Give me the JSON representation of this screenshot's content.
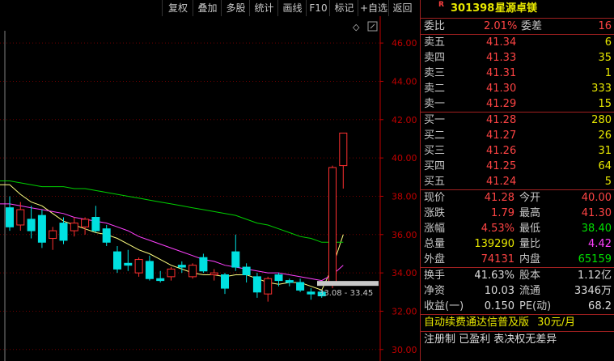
{
  "toolbar": {
    "items": [
      "复权",
      "叠加",
      "多股",
      "统计",
      "画线",
      "F10",
      "标记",
      "+自选",
      "返回"
    ]
  },
  "chart_area": {
    "diamond_icon": "◇",
    "y_axis_labels": [
      "46.00",
      "44.00",
      "42.00",
      "40.00",
      "38.00",
      "36.00",
      "34.00",
      "32.00",
      "30.00"
    ],
    "range_label": "33.08 - 33.45"
  },
  "chart_data": {
    "type": "candlestick",
    "ylim": [
      29.4,
      47.4
    ],
    "candles": [
      {
        "o": 37.4,
        "h": 38.0,
        "l": 36.2,
        "c": 36.4
      },
      {
        "o": 36.5,
        "h": 37.7,
        "l": 36.2,
        "c": 37.3
      },
      {
        "o": 36.8,
        "h": 37.5,
        "l": 35.8,
        "c": 36.2
      },
      {
        "o": 37.0,
        "h": 37.3,
        "l": 35.3,
        "c": 35.6
      },
      {
        "o": 35.8,
        "h": 36.4,
        "l": 35.2,
        "c": 36.2
      },
      {
        "o": 36.6,
        "h": 36.9,
        "l": 35.5,
        "c": 35.7
      },
      {
        "o": 36.2,
        "h": 36.9,
        "l": 35.9,
        "c": 36.6
      },
      {
        "o": 36.4,
        "h": 36.9,
        "l": 36.0,
        "c": 36.8
      },
      {
        "o": 36.9,
        "h": 37.5,
        "l": 36.1,
        "c": 36.2
      },
      {
        "o": 36.3,
        "h": 36.5,
        "l": 35.4,
        "c": 35.6
      },
      {
        "o": 35.1,
        "h": 35.4,
        "l": 34.0,
        "c": 34.2
      },
      {
        "o": 34.5,
        "h": 35.2,
        "l": 34.1,
        "c": 34.4
      },
      {
        "o": 34.0,
        "h": 34.8,
        "l": 33.8,
        "c": 34.7
      },
      {
        "o": 34.6,
        "h": 34.9,
        "l": 33.6,
        "c": 33.7
      },
      {
        "o": 33.7,
        "h": 34.1,
        "l": 33.5,
        "c": 33.6
      },
      {
        "o": 33.8,
        "h": 34.3,
        "l": 33.6,
        "c": 34.2
      },
      {
        "o": 34.4,
        "h": 34.6,
        "l": 34.0,
        "c": 34.3
      },
      {
        "o": 33.8,
        "h": 34.5,
        "l": 33.7,
        "c": 34.4
      },
      {
        "o": 34.8,
        "h": 35.0,
        "l": 34.0,
        "c": 34.1
      },
      {
        "o": 33.9,
        "h": 34.2,
        "l": 33.6,
        "c": 34.0
      },
      {
        "o": 33.9,
        "h": 34.0,
        "l": 32.9,
        "c": 33.2
      },
      {
        "o": 35.1,
        "h": 36.0,
        "l": 34.1,
        "c": 34.3
      },
      {
        "o": 34.3,
        "h": 34.5,
        "l": 33.5,
        "c": 33.9
      },
      {
        "o": 33.8,
        "h": 34.0,
        "l": 32.7,
        "c": 33.0
      },
      {
        "o": 32.9,
        "h": 33.8,
        "l": 32.5,
        "c": 33.7
      },
      {
        "o": 33.9,
        "h": 34.0,
        "l": 33.3,
        "c": 33.6
      },
      {
        "o": 33.6,
        "h": 33.7,
        "l": 33.3,
        "c": 33.5
      },
      {
        "o": 33.5,
        "h": 33.7,
        "l": 33.0,
        "c": 33.1
      },
      {
        "o": 33.0,
        "h": 33.2,
        "l": 32.6,
        "c": 32.9
      },
      {
        "o": 33.0,
        "h": 33.1,
        "l": 32.7,
        "c": 32.8
      },
      {
        "o": 33.5,
        "h": 39.6,
        "l": 33.2,
        "c": 39.5
      },
      {
        "o": 39.6,
        "h": 41.3,
        "l": 38.4,
        "c": 41.3
      }
    ],
    "ma_lines": [
      {
        "name": "ma5",
        "color": "#ffff80",
        "values": [
          38.6,
          38.1,
          37.7,
          37.5,
          37.1,
          36.7,
          36.5,
          36.3,
          36.1,
          36.0,
          35.8,
          35.5,
          35.2,
          35.0,
          34.7,
          34.4,
          34.2,
          34.0,
          33.9,
          33.9,
          33.8,
          33.9,
          33.9,
          33.7,
          33.5,
          33.4,
          33.5,
          33.5,
          33.3,
          33.1,
          34.3,
          36.0
        ]
      },
      {
        "name": "ma10",
        "color": "#ff40ff",
        "values": [
          37.6,
          37.5,
          37.4,
          37.3,
          37.2,
          37.1,
          36.9,
          36.8,
          36.7,
          36.6,
          36.4,
          36.2,
          35.9,
          35.7,
          35.5,
          35.3,
          35.1,
          34.9,
          34.7,
          34.6,
          34.4,
          34.3,
          34.2,
          34.1,
          34.0,
          34.0,
          33.9,
          33.8,
          33.7,
          33.6,
          33.9,
          34.4
        ]
      },
      {
        "name": "ma20",
        "color": "#00d000",
        "values": [
          38.8,
          38.7,
          38.6,
          38.5,
          38.5,
          38.5,
          38.4,
          38.4,
          38.3,
          38.2,
          38.1,
          38.0,
          37.9,
          37.8,
          37.7,
          37.6,
          37.5,
          37.4,
          37.3,
          37.2,
          37.1,
          37.0,
          36.8,
          36.6,
          36.5,
          36.3,
          36.1,
          35.9,
          35.8,
          35.6,
          35.6,
          35.6
        ]
      }
    ]
  },
  "quote_panel": {
    "title_mark": "R",
    "code": "301398",
    "name": "星源卓镁",
    "weibi_label": "委比",
    "weibi_value": "2.01%",
    "weicha_label": "委差",
    "weicha_value": "16",
    "asks": [
      {
        "label": "卖五",
        "price": "41.34",
        "vol": "6"
      },
      {
        "label": "卖四",
        "price": "41.33",
        "vol": "35"
      },
      {
        "label": "卖三",
        "price": "41.31",
        "vol": "1"
      },
      {
        "label": "卖二",
        "price": "41.30",
        "vol": "333"
      },
      {
        "label": "卖一",
        "price": "41.29",
        "vol": "15"
      }
    ],
    "bids": [
      {
        "label": "买一",
        "price": "41.28",
        "vol": "280"
      },
      {
        "label": "买二",
        "price": "41.27",
        "vol": "26"
      },
      {
        "label": "买三",
        "price": "41.26",
        "vol": "31"
      },
      {
        "label": "买四",
        "price": "41.25",
        "vol": "64"
      },
      {
        "label": "买五",
        "price": "41.24",
        "vol": "5"
      }
    ],
    "stats": [
      {
        "l1": "现价",
        "v1": "41.28",
        "c1": "red",
        "l2": "今开",
        "v2": "40.00",
        "c2": "red"
      },
      {
        "l1": "涨跌",
        "v1": "1.79",
        "c1": "red",
        "l2": "最高",
        "v2": "41.30",
        "c2": "red"
      },
      {
        "l1": "涨幅",
        "v1": "4.53%",
        "c1": "red",
        "l2": "最低",
        "v2": "38.40",
        "c2": "green"
      },
      {
        "l1": "总量",
        "v1": "139290",
        "c1": "yel",
        "l2": "量比",
        "v2": "4.42",
        "c2": "mag"
      },
      {
        "l1": "外盘",
        "v1": "74131",
        "c1": "red",
        "l2": "内盘",
        "v2": "65159",
        "c2": "green"
      }
    ],
    "stats2": [
      {
        "l1": "换手",
        "v1": "41.63%",
        "c1": "wht",
        "l2": "股本",
        "v2": "1.12亿",
        "c2": "wht"
      },
      {
        "l1": "净资",
        "v1": "10.03",
        "c1": "wht",
        "l2": "流通",
        "v2": "3346万",
        "c2": "wht"
      },
      {
        "l1": "收益(一)",
        "v1": "0.150",
        "c1": "wht",
        "l2": "PE(动)",
        "v2": "68.2",
        "c2": "wht"
      }
    ],
    "ad_line": "自动续费通达信普及版",
    "ad_price": "30元/月",
    "tags_line": "注册制 已盈利 表决权无差异"
  },
  "colors": {
    "up": "#ff3030",
    "down": "#00e0e0",
    "axis": "#c00000",
    "grid": "#700000",
    "range_box": "#c8c8c8"
  }
}
